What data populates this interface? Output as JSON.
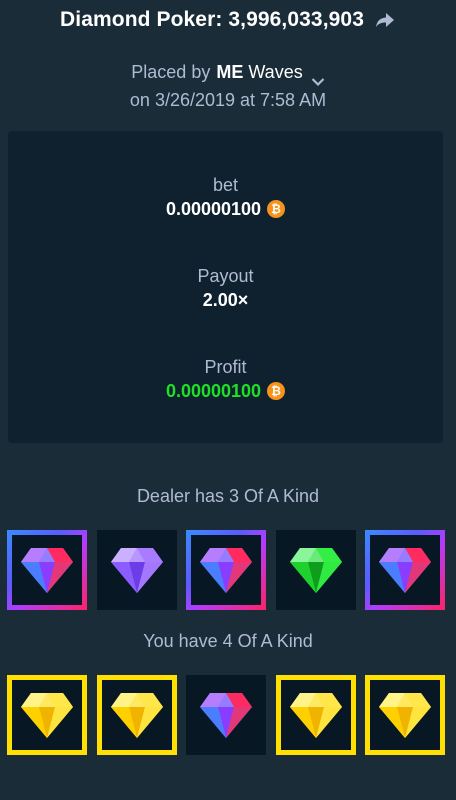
{
  "header": {
    "title": "Diamond Poker: 3,996,033,903",
    "share_icon": "share-arrow-icon"
  },
  "meta": {
    "placed_by_label": "Placed by",
    "user_first": "ME",
    "user_second": "Waves",
    "date_line": "on 3/26/2019 at 7:58 AM"
  },
  "stats": {
    "bet_label": "bet",
    "bet_value": "0.00000100",
    "payout_label": "Payout",
    "payout_value": "2.00×",
    "profit_label": "Profit",
    "profit_value": "0.00000100",
    "currency_symbol": "₿",
    "profit_color": "#1fe026"
  },
  "dealer": {
    "label": "Dealer has 3 Of A Kind",
    "cards": [
      {
        "gem": "blue-red",
        "frame": "rainbow"
      },
      {
        "gem": "purple",
        "frame": "none"
      },
      {
        "gem": "blue-red",
        "frame": "rainbow"
      },
      {
        "gem": "green",
        "frame": "none"
      },
      {
        "gem": "blue-red",
        "frame": "rainbow"
      }
    ]
  },
  "player": {
    "label": "You have 4 Of A Kind",
    "cards": [
      {
        "gem": "yellow",
        "frame": "yellow"
      },
      {
        "gem": "yellow",
        "frame": "yellow"
      },
      {
        "gem": "blue-red",
        "frame": "none"
      },
      {
        "gem": "yellow",
        "frame": "yellow"
      },
      {
        "gem": "yellow",
        "frame": "yellow"
      }
    ]
  },
  "colors": {
    "background": "#1a2c38",
    "panel": "#0f212e",
    "card_bg": "#071824",
    "yellow_frame": "#ffe000",
    "bitcoin": "#f7931a"
  }
}
